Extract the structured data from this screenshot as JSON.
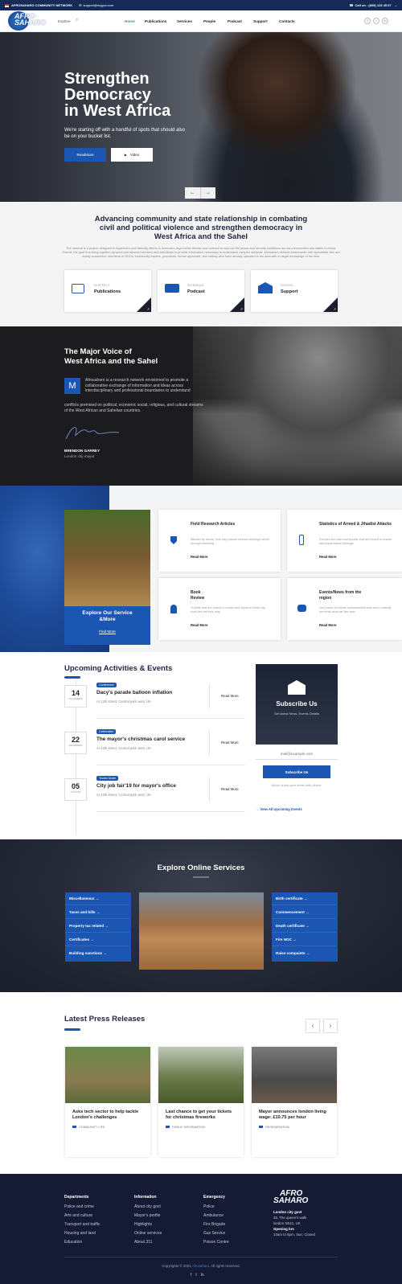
{
  "topbar": {
    "network": "AFROSAHARO COMMUNITY NETWORK",
    "email": "support@mygov.com",
    "call": "Call on : (609) 123 45 67"
  },
  "nav": {
    "logo_line1": "AFRO",
    "logo_line2": "SAHARO",
    "explore": "Explore",
    "items": [
      "Home",
      "Publications",
      "Services",
      "People",
      "Podcast",
      "Support",
      "Contacts"
    ]
  },
  "hero": {
    "title_line1": "Strengthen",
    "title_line2": "Democracy",
    "title_line3": "in West Africa",
    "subtitle": "We're starting off with a handful of spots that should also be on your bucket list.",
    "readmore": "ReadMore",
    "video": "Video"
  },
  "about": {
    "heading": "Advancing community and state relationship in combating civil and political violence and strengthen democracy in West Africa and the Sahel",
    "body": "The network is a project designed to implement and intensify efforts to overcome asymmetric threats and violence to improve the peace and security conditions across communities and states in Africa. Overall, the goal is to bring together dynamic and talented scholars and individuals to provide information necessary to understand complex subjects. Afrosaharo network bestdrawler with specialists who are mostly academics, members of NGOs, community leaders, journalists, former diplomats, and military who have already operated in the area with in-depth knowledge of the field.",
    "cards": [
      {
        "small": "IN EFFECT",
        "label": "Publications"
      },
      {
        "small": "SCHEDULE",
        "label": "Podcast"
      },
      {
        "small": "SCHOOL",
        "label": "Support"
      }
    ]
  },
  "voice": {
    "title_line1": "The Major Voice of",
    "title_line2": "West Africa and the Sahel",
    "dropcap": "M",
    "para1": "Afrosaharo is a research network envisioned to promote a collaborative exchange of information and ideas across interdisciplinary and professional boundaries to understand",
    "para2": "conflicts premised on political, economic social, religious, and cultural streams of the West African and Sahelian countries.",
    "name": "BRENDON GARREY",
    "role": "London city mayor"
  },
  "services": {
    "explore_title": "Explore Our Service &More",
    "find_more": "Find More",
    "items": [
      {
        "title": "Field Research Articles",
        "desc": "Blinded by desire, that they cannot foresee bulbings which through shrinking.",
        "link": "Read More"
      },
      {
        "title": "Statistics of Armed & Jihadist Attacks",
        "desc": "Foresee the pain and trouble that are bound to ensue; and equal blame belongs.",
        "link": "Read More"
      },
      {
        "title": "Book Review",
        "desc": "Trouble that are bound to ensue and equal to those city work the fail their duty.",
        "link": "Read More"
      },
      {
        "title": "Events/News from the region",
        "desc": "Our power of choice untrammelled and when nothing prevents what we like best.",
        "link": "Read More"
      }
    ]
  },
  "events": {
    "heading": "Upcoming Activities & Events",
    "items": [
      {
        "day": "14",
        "month": "DECEMBER",
        "tag": "Conference",
        "title": "Dacy's parade balloon inflation",
        "loc": "At 12th street, Central park west, UK",
        "more": "Read More"
      },
      {
        "day": "22",
        "month": "DECEMBER",
        "tag": "Celebration",
        "title": "The mayor's christmas carol service",
        "loc": "At 12th street, Central park west, UK",
        "more": "Read More"
      },
      {
        "day": "05",
        "month": "JANUARY",
        "tag": "Tourist Guide",
        "title": "City job fair'19 for mayor's office",
        "loc": "At 12th street, Central park west, UK",
        "more": "Read More"
      }
    ],
    "subscribe_title": "Subscribe Us",
    "subscribe_sub": "Get latest News, Events Details",
    "email_placeholder": "mail@example.com",
    "subscribe_btn": "Subscribe Us",
    "subscribe_note": "Never share your email with others.",
    "view_all": "View All Upcoming Events"
  },
  "online": {
    "heading": "Explore Online Services",
    "left": [
      "Miscellaneous",
      "Taxes and bills",
      "Property tax related",
      "Certificates",
      "Building sanctions"
    ],
    "right": [
      "Birth certificate",
      "Commencement",
      "Death certificate",
      "Fire NOC",
      "Raise compaints"
    ]
  },
  "press": {
    "heading": "Latest Press Releases",
    "items": [
      {
        "title": "Asks tech sector to help tackle London's challenges",
        "cat": "COMMUNITY LIFE"
      },
      {
        "title": "Last chance to get your tickets for christmas fireworks",
        "cat": "PUBLIC INFORMATION"
      },
      {
        "title": "Mayor announces london living wage: £10.75 per hour",
        "cat": "REGENERATION"
      }
    ]
  },
  "footer": {
    "cols": [
      {
        "title": "Departments",
        "items": [
          "Police and crime",
          "Arts and culture",
          "Transport and traffic",
          "Housing and land",
          "Education"
        ]
      },
      {
        "title": "Information",
        "items": [
          "About city govt",
          "Mayor's profile",
          "Highlights",
          "Online services",
          "About 311"
        ]
      },
      {
        "title": "Emergency",
        "items": [
          "Police",
          "Ambulance",
          "Fire Brigade",
          "Gas Service",
          "Poison Centre"
        ]
      }
    ],
    "logo_line1": "AFRO",
    "logo_line2": "SAHARO",
    "govt": "London city govt",
    "addr1": "45, The queen's walk",
    "addr2": "london SE41, UK",
    "hours_label": "Opening hrs",
    "hours": "10am to 6pm, Sun: Closed",
    "copyright_pre": "Copyrights © 2021",
    "copyright_brand": "Afrosaharo",
    "copyright_post": ". All rights reserved."
  },
  "colors": {
    "navy": "#162a57",
    "blue": "#1c56b3",
    "green": "#2aa35b"
  }
}
